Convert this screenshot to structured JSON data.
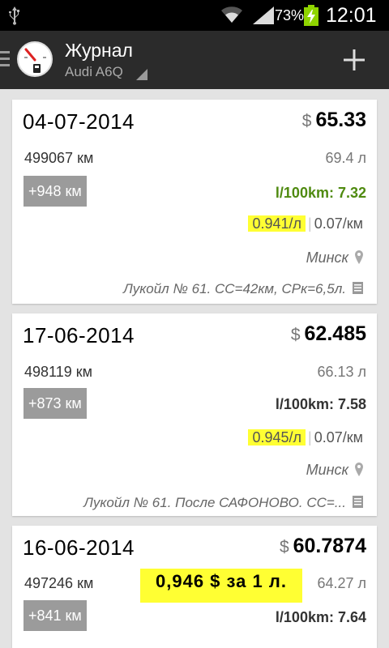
{
  "status": {
    "battery_pct": "73%",
    "time": "12:01"
  },
  "header": {
    "title": "Журнал",
    "subtitle": "Audi A6Q"
  },
  "entries": [
    {
      "date": "04-07-2014",
      "currency": "$",
      "price": "65.33",
      "odometer": "499067 км",
      "volume": "69.4 л",
      "distance": "+948 км",
      "consumption": "l/100km: 7.32",
      "price_per_l": "0.941/л",
      "cost_per_km": "0.07/км",
      "city": "Минск",
      "note": "Лукойл № 61. СС=42км, СРк=6,5л."
    },
    {
      "date": "17-06-2014",
      "currency": "$",
      "price": "62.485",
      "odometer": "498119 км",
      "volume": "66.13 л",
      "distance": "+873 км",
      "consumption": "l/100km: 7.58",
      "price_per_l": "0.945/л",
      "cost_per_km": "0.07/км",
      "city": "Минск",
      "note": "Лукойл № 61. После САФОНОВО. СС=..."
    },
    {
      "date": "16-06-2014",
      "currency": "$",
      "price": "60.7874",
      "odometer": "497246 км",
      "volume": "64.27 л",
      "distance": "+841 км",
      "consumption": "l/100km: 7.64"
    }
  ],
  "annotation": "0,946 $ за 1 л."
}
